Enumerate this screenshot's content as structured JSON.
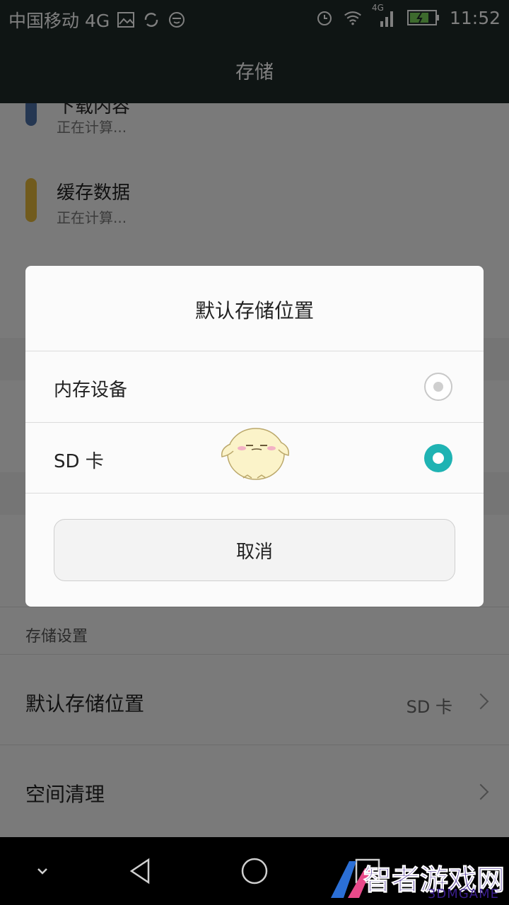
{
  "status_bar": {
    "carrier": "中国移动 4G",
    "network_badge": "4G",
    "time": "11:52",
    "icons": [
      "gallery-icon",
      "sync-icon",
      "emoji-icon",
      "alarm-icon",
      "wifi-icon",
      "signal-icon",
      "battery-icon"
    ]
  },
  "app_bar": {
    "title": "存储"
  },
  "list_rows": [
    {
      "label": "下载内容",
      "subtitle": "正在计算...",
      "color": "#4a6fa5"
    },
    {
      "label": "缓存数据",
      "subtitle": "正在计算...",
      "color": "#e3b63b"
    }
  ],
  "storage_settings": {
    "section_title": "存储设置",
    "default_location_label": "默认存储位置",
    "default_location_value": "SD 卡",
    "cleanup_label": "空间清理"
  },
  "dialog": {
    "title": "默认存储位置",
    "options": [
      {
        "label": "内存设备",
        "selected": false
      },
      {
        "label": "SD 卡",
        "selected": true
      }
    ],
    "cancel_label": "取消",
    "accent_color": "#1fb3b3"
  },
  "watermark": {
    "text": "智者游戏网",
    "sub": "3DMGAME"
  }
}
